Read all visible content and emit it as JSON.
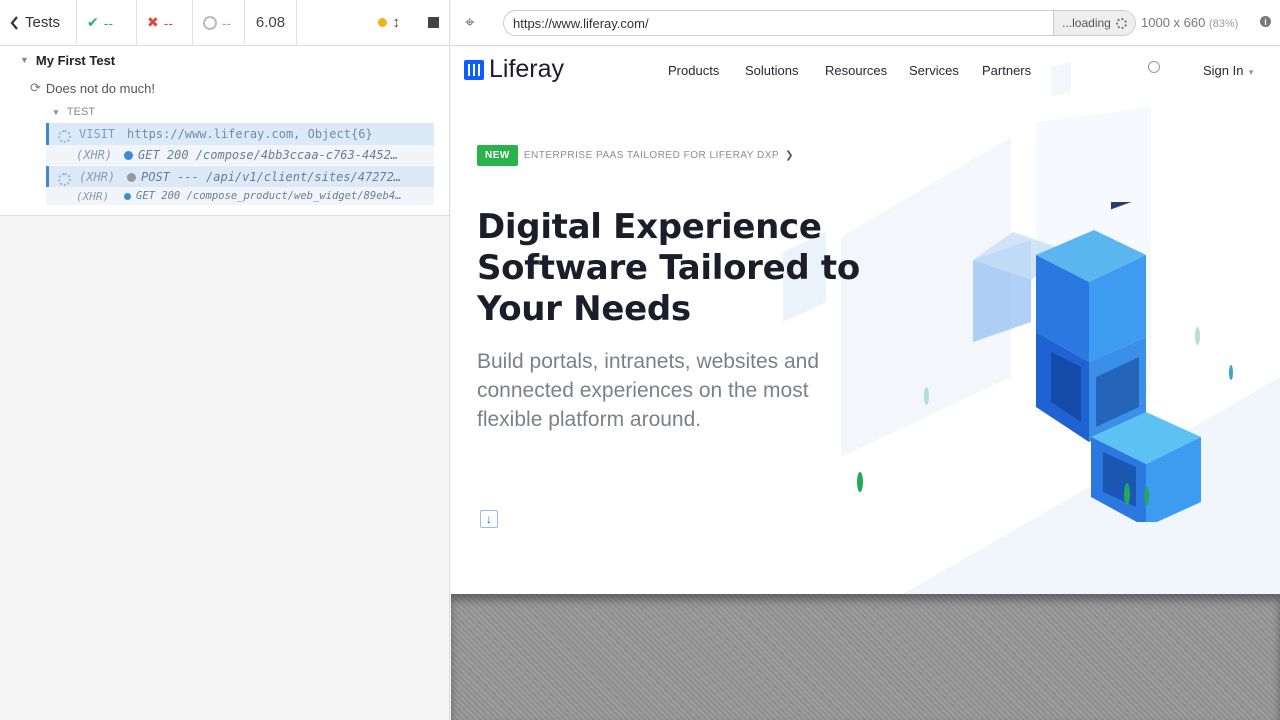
{
  "reporter": {
    "back_label": "Tests",
    "passed_count": "--",
    "failed_count": "--",
    "pending_count": "--",
    "duration": "6.08",
    "suite_title": "My First Test",
    "test_title": "Does not do much!",
    "section_label": "TEST",
    "commands": [
      {
        "name": "VISIT",
        "message": "https://www.liferay.com, Object{6}"
      },
      {
        "name": "(XHR)",
        "message": "GET 200 /compose/4bb3ccaa-c763-4452…",
        "dot_color": "#3d8ad8"
      },
      {
        "name": "(XHR)",
        "message": "POST --- /api/v1/client/sites/47272…",
        "dot_color": "#999999"
      },
      {
        "name": "(XHR)",
        "message": "GET 200 /compose_product/web_widget/89eb4…",
        "dot_color": "#3d8ad8"
      }
    ]
  },
  "browser": {
    "url": "https://www.liferay.com/",
    "loading_label": "...loading",
    "viewport": "1000 x 660",
    "zoom": "(83%)"
  },
  "site": {
    "logo": "Liferay",
    "nav": [
      "Products",
      "Solutions",
      "Resources",
      "Services",
      "Partners"
    ],
    "sign_in": "Sign In",
    "badge_new": "NEW",
    "badge_text": "ENTERPRISE PAAS TAILORED FOR LIFERAY DXP",
    "headline": "Digital Experience Software Tailored to Your Needs",
    "subhead": "Build portals, intranets, websites and connected experiences on the most flexible platform around."
  }
}
